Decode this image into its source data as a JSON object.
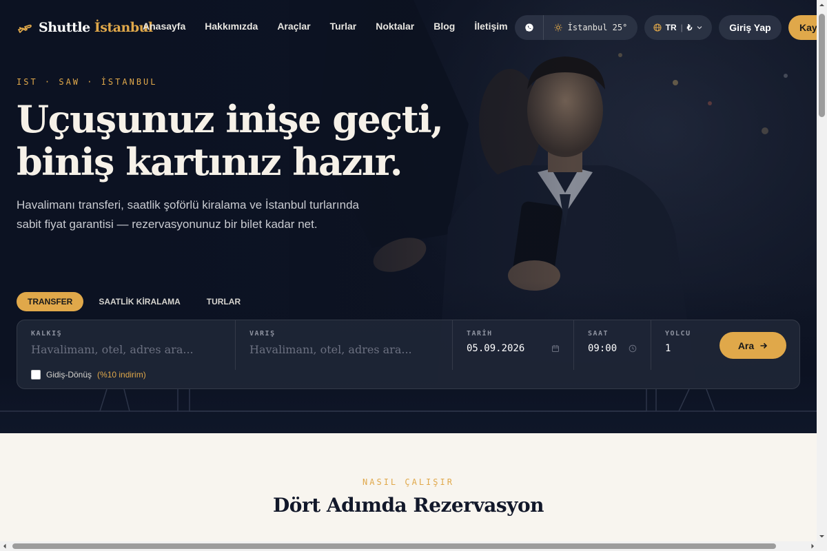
{
  "brand": {
    "name": "Shuttle",
    "accent": "İstanbul"
  },
  "nav": [
    "Anasayfa",
    "Hakkımızda",
    "Araçlar",
    "Turlar",
    "Noktalar",
    "Blog",
    "İletişim"
  ],
  "topbar": {
    "weather": "İstanbul 25°",
    "language": "TR",
    "currency": "₺",
    "login_label": "Giriş Yap",
    "register_label": "Kay"
  },
  "hero": {
    "eyebrow": "IST · SAW · İSTANBUL",
    "title_line1": "Uçuşunuz inişe geçti,",
    "title_line2": "biniş kartınız hazır.",
    "subtitle": "Havalimanı transferi, saatlik şoförlü kiralama ve İstanbul turlarında sabit fiyat garantisi — rezervasyonunuz bir bilet kadar net."
  },
  "tabs": [
    "TRANSFER",
    "SAATLİK KİRALAMA",
    "TURLAR"
  ],
  "search": {
    "from_label": "KALKIŞ",
    "from_placeholder": "Havalimanı, otel, adres ara...",
    "to_label": "VARIŞ",
    "to_placeholder": "Havalimanı, otel, adres ara...",
    "date_label": "TARİH",
    "date_value": "05.09.2026",
    "time_label": "SAAT",
    "time_value": "09:00",
    "pax_label": "YOLCU",
    "pax_value": "1",
    "button_label": "Ara",
    "roundtrip_label": "Gidiş-Dönüş",
    "roundtrip_discount": "(%10 indirim)"
  },
  "section": {
    "eyebrow": "NASIL ÇALIŞIR",
    "title": "Dört Adımda Rezervasyon"
  },
  "colors": {
    "accent": "#e0a84a",
    "navy": "#0f1729",
    "cream": "#f8f5ef"
  }
}
